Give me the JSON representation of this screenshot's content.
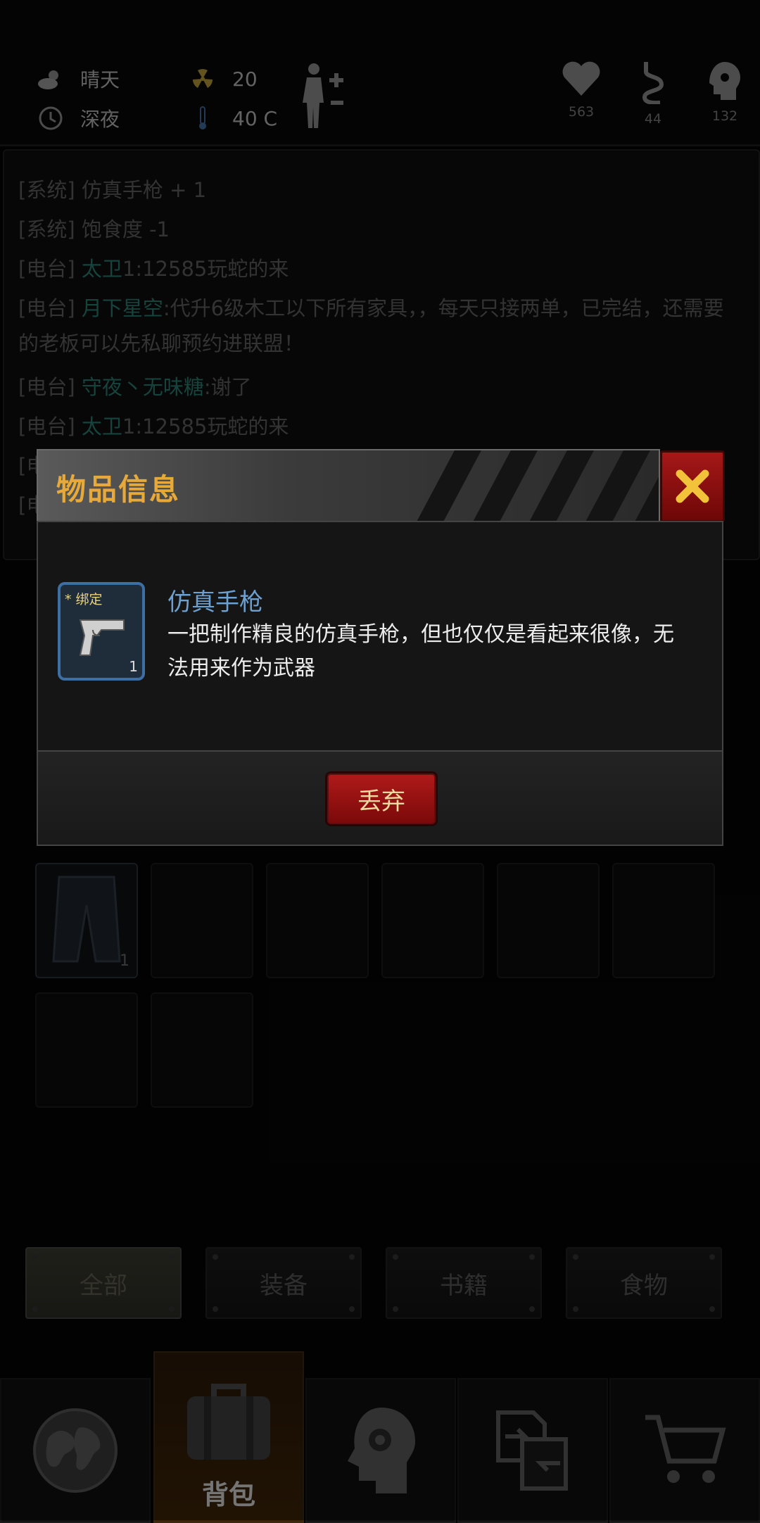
{
  "status": {
    "weather": "晴天",
    "time_of_day": "深夜",
    "radiation": "20",
    "temperature": "40 C",
    "health": "563",
    "hunger": "44",
    "sanity": "132"
  },
  "chat": {
    "lines": [
      {
        "channel": "[系统]",
        "nick": "",
        "text": "仿真手枪 + 1"
      },
      {
        "channel": "[系统]",
        "nick": "",
        "text": "饱食度 -1"
      },
      {
        "channel": "[电台]",
        "nick": "太卫",
        "text": "1:12585玩蛇的来"
      },
      {
        "channel": "[电台]",
        "nick": "月下星空",
        "text": ":代升6级木工以下所有家具，，每天只接两单，已完结，还需要"
      },
      {
        "channel": "",
        "nick": "",
        "text": "的老板可以先私聊预约进联盟！"
      },
      {
        "channel": "[电台]",
        "nick": "守夜丶无味糖",
        "text": ":谢了"
      },
      {
        "channel": "[电台]",
        "nick": "太卫",
        "text": "1:12585玩蛇的来"
      },
      {
        "channel": "[电",
        "nick": "",
        "text": ""
      },
      {
        "channel": "[电",
        "nick": "",
        "text": ""
      }
    ]
  },
  "inventory": {
    "pants_count": "1",
    "slot_count_behind": "24"
  },
  "filters": [
    "全部",
    "装备",
    "书籍",
    "食物"
  ],
  "nav": {
    "active_label": "背包"
  },
  "modal": {
    "title": "物品信息",
    "item_badge": "* 绑定",
    "item_count": "1",
    "item_name": "仿真手枪",
    "item_desc": "一把制作精良的仿真手枪，但也仅仅是看起来很像，无法用来作为武器",
    "discard_label": "丢弃"
  },
  "colors": {
    "title_gold": "#e6a93a",
    "item_name_blue": "#6ea0cf",
    "nick_teal": "#2a7a70",
    "button_red": "#a51818"
  }
}
